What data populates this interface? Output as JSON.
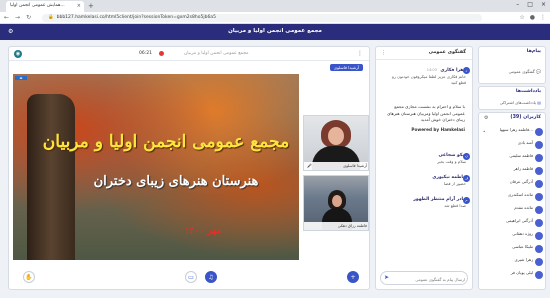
{
  "browser": {
    "tab_title": "همایش عمومی انجمن اولیا...",
    "url": "bbb127.hamkelasi.co/html5client/join?sessionToken=gxm2s8ho5jb6a5",
    "nav_icons": [
      "back-icon",
      "forward-icon",
      "reload-icon"
    ]
  },
  "app": {
    "title": "مجمع عمومی انجمن اولیا و مربیان"
  },
  "video": {
    "timer": "06:21",
    "title": "مجمع عمومی انجمن اولیا و مربیان",
    "presenter_badge": "آرشیدا قاسلوی",
    "slide": {
      "corner": "",
      "line1": "مجمع عمومی انجمن اولیا و مربیان",
      "line2": "هنرستان هنرهای زیبای دختران",
      "line3": "مهر ۱۴۰۰"
    },
    "cams": [
      {
        "label": "آرشیدا قاسلوی"
      },
      {
        "label": "فاطمه رزاق دهکی"
      }
    ],
    "controls": [
      "hand-icon",
      "share-screen-icon",
      "headphones-icon",
      "plus-icon"
    ]
  },
  "chat": {
    "header": "گفتگوی عمومی",
    "messages": [
      {
        "name": "زهرا فکاری",
        "time": "14:03",
        "text": "خانم فکاری عزیز لطفا میکروفون خودتون رو قطع کنید"
      },
      {
        "name": "نیکو شجاعی",
        "time": "",
        "text": "سلام و وقت بخیر"
      },
      {
        "name": "فاطمه نیکپوری",
        "time": "",
        "text": "حضور از فضا"
      },
      {
        "name": "مادر آرام منتظر الظهور",
        "time": "",
        "text": "صدا قطع شد"
      }
    ],
    "welcome": "با سلام و احترام به نشست مجازی مجمع عمومی انجمن اولیا ومربیان هنرستان هنرهای زیبای دختران خوش آمدید",
    "powered_by": "Powered by Hamkelasi",
    "input_placeholder": "ارسال پیام به گفتگوی عمومی"
  },
  "sidebar": {
    "messages_title": "پیام‌ها",
    "public_chat": "گفتگوی عمومی",
    "notes_title": "یادداشت‌ها",
    "shared_notes": "یادداشت‌های اشتراکی",
    "users_title": "کاربران (39)",
    "users": [
      {
        "name": "فاطمه زهرا سیهپا...",
        "sub": ""
      },
      {
        "name": "آمنه بادی",
        "sub": ""
      },
      {
        "name": "فاطمه سلیمی",
        "sub": ""
      },
      {
        "name": "فاطمه زاهر",
        "sub": ""
      },
      {
        "name": "آذرگنی عرفان",
        "sub": ""
      },
      {
        "name": "مائده اسکندری",
        "sub": ""
      },
      {
        "name": "مائده مقدم",
        "sub": ""
      },
      {
        "name": "آذرگنی ابراهیمی",
        "sub": ""
      },
      {
        "name": "روژه دهقانی",
        "sub": ""
      },
      {
        "name": "ملیکا عباسی",
        "sub": ""
      },
      {
        "name": "زهرا شیری",
        "sub": ""
      },
      {
        "name": "لیلی پویان فر",
        "sub": ""
      }
    ]
  }
}
